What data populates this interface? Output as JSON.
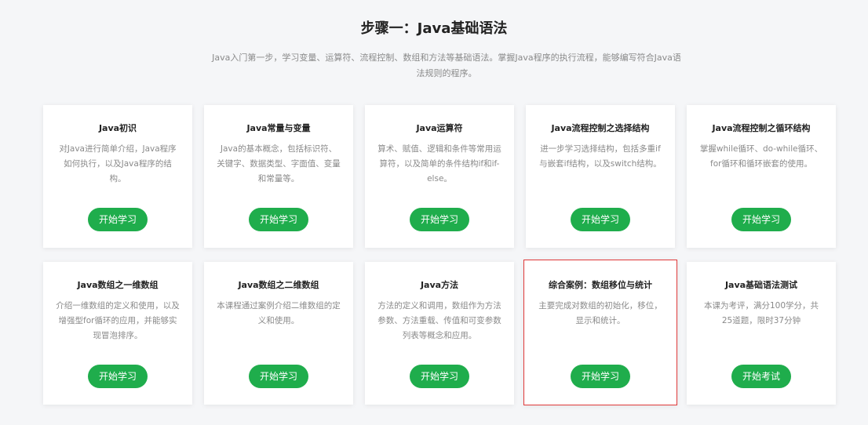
{
  "section": {
    "title": "步骤一：Java基础语法",
    "description": "Java入门第一步，学习变量、运算符、流程控制、数组和方法等基础语法。掌握Java程序的执行流程，能够编写符合Java语法规则的程序。"
  },
  "cards": [
    {
      "title": "Java初识",
      "desc": "对Java进行简单介绍，Java程序如何执行，以及Java程序的结构。",
      "button": "开始学习"
    },
    {
      "title": "Java常量与变量",
      "desc": "Java的基本概念，包括标识符、关键字、数据类型、字面值、变量和常量等。",
      "button": "开始学习"
    },
    {
      "title": "Java运算符",
      "desc": "算术、赋值、逻辑和条件等常用运算符，以及简单的条件结构if和if-else。",
      "button": "开始学习"
    },
    {
      "title": "Java流程控制之选择结构",
      "desc": "进一步学习选择结构，包括多重if与嵌套if结构，以及switch结构。",
      "button": "开始学习"
    },
    {
      "title": "Java流程控制之循环结构",
      "desc": "掌握while循环、do-while循环、for循环和循环嵌套的使用。",
      "button": "开始学习"
    },
    {
      "title": "Java数组之一维数组",
      "desc": "介绍一维数组的定义和使用，以及增强型for循环的应用，并能够实现冒泡排序。",
      "button": "开始学习"
    },
    {
      "title": "Java数组之二维数组",
      "desc": "本课程通过案例介绍二维数组的定义和使用。",
      "button": "开始学习"
    },
    {
      "title": "Java方法",
      "desc": "方法的定义和调用，数组作为方法参数、方法重载、传值和可变参数列表等概念和应用。",
      "button": "开始学习"
    },
    {
      "title": "综合案例：数组移位与统计",
      "desc": "主要完成对数组的初始化，移位，显示和统计。",
      "button": "开始学习"
    },
    {
      "title": "Java基础语法测试",
      "desc": "本课为考评，满分100学分，共25道题，限时37分钟",
      "button": "开始考试"
    }
  ]
}
